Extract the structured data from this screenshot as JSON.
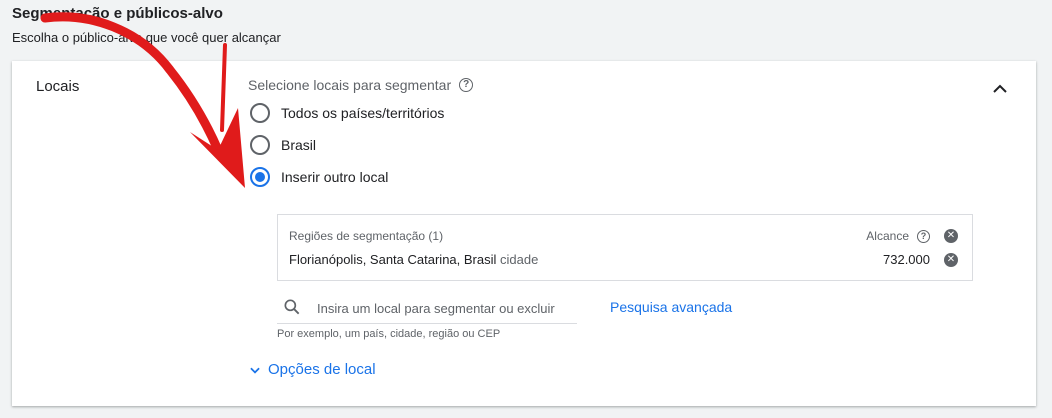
{
  "section": {
    "title": "Segmentação e públicos-alvo",
    "subtitle": "Escolha o público-alvo que você quer alcançar"
  },
  "card": {
    "label": "Locais",
    "select_label": "Selecione locais para segmentar",
    "help_glyph": "?",
    "options": [
      {
        "label": "Todos os países/territórios",
        "checked": false
      },
      {
        "label": "Brasil",
        "checked": false
      },
      {
        "label": "Inserir outro local",
        "checked": true
      }
    ],
    "regions": {
      "header": "Regiões de segmentação (1)",
      "reach_header": "Alcance",
      "rows": [
        {
          "name": "Florianópolis, Santa Catarina, Brasil",
          "type": "cidade",
          "reach": "732.000"
        }
      ]
    },
    "search": {
      "placeholder": "Insira um local para segmentar ou excluir",
      "value": ""
    },
    "advanced_search": "Pesquisa avançada",
    "hint": "Por exemplo, um país, cidade, região ou CEP",
    "location_options": "Opções de local"
  },
  "colors": {
    "accent": "#1a73e8",
    "annotation_arrow": "#e01b1b"
  },
  "icons": {
    "collapse": "chevron-up-icon",
    "search": "search-icon",
    "remove": "close-circle-icon",
    "expand_options": "chevron-down-icon",
    "annotation": "red-arrow-annotation"
  }
}
